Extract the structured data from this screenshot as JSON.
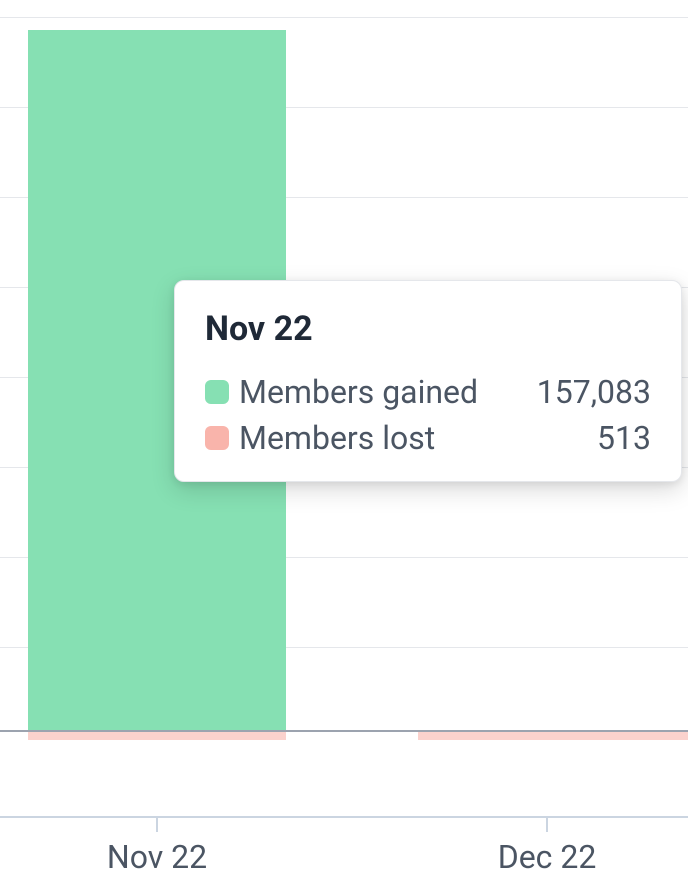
{
  "chart_data": {
    "type": "bar",
    "categories": [
      "Nov 22",
      "Dec 22"
    ],
    "series": [
      {
        "name": "Members gained",
        "color": "#86e0b3",
        "values": [
          157083,
          null
        ]
      },
      {
        "name": "Members lost",
        "color": "#f9b4ab",
        "values": [
          513,
          null
        ]
      }
    ],
    "gridlines_count": 8
  },
  "tooltip": {
    "title": "Nov 22",
    "rows": [
      {
        "label": "Members gained",
        "value": "157,083",
        "swatch": "green"
      },
      {
        "label": "Members lost",
        "value": "513",
        "swatch": "red"
      }
    ]
  },
  "xaxis": {
    "labels": [
      "Nov 22",
      "Dec 22"
    ]
  }
}
